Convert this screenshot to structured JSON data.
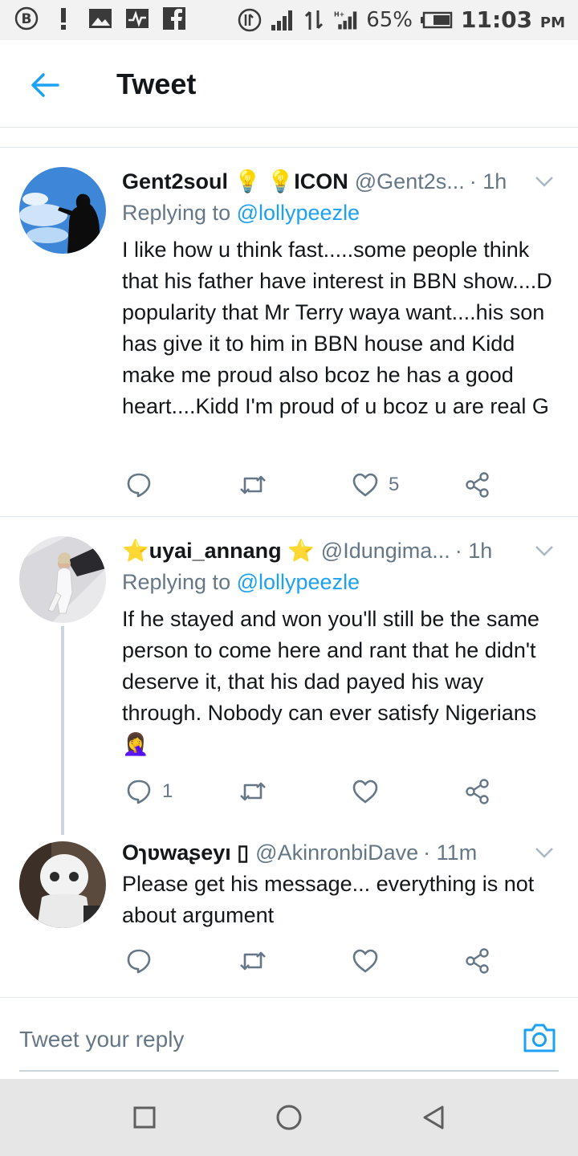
{
  "status_bar": {
    "battery": "65%",
    "time": "11:03",
    "ampm": "PM",
    "net_type": "H+"
  },
  "header": {
    "title": "Tweet"
  },
  "tweets": [
    {
      "name": "Gent2soul 💡 💡ICON",
      "handle": "@Gent2s...",
      "time": "· 1h",
      "replying_prefix": "Replying to ",
      "replying_to": "@lollypeezle",
      "text": "I like how u think fast.....some people think that his father have interest in BBN show....D popularity that Mr Terry waya want....his son has give it to him in BBN house and Kidd make me proud also bcoz he has a good heart....Kidd I'm proud of u bcoz u are real G",
      "replies": "",
      "likes": "5"
    },
    {
      "name": "⭐uyai_annang ⭐",
      "handle": "@Idungima...",
      "time": "· 1h",
      "replying_prefix": "Replying to ",
      "replying_to": "@lollypeezle",
      "text": "If he stayed and won you'll still be the same person to come here and rant that he didn't deserve it, that his dad payed his way through. Nobody can ever satisfy Nigerians 🤦‍♀️",
      "replies": "1",
      "likes": ""
    },
    {
      "name": "Oɿʋwaʂeyı ▯",
      "handle": "@AkinronbiDave",
      "time": "· 11m",
      "text": "Please get his message... everything is not about argument",
      "replies": "",
      "likes": ""
    }
  ],
  "reply_box": {
    "placeholder": "Tweet your reply"
  },
  "colors": {
    "accent": "#1da1f2",
    "muted": "#657786",
    "divider": "#e1e8ed"
  }
}
